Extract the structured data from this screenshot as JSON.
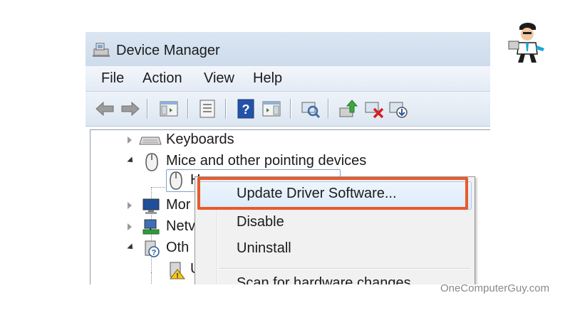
{
  "window": {
    "title": "Device Manager"
  },
  "menu": {
    "items": [
      "File",
      "Action",
      "View",
      "Help"
    ]
  },
  "toolbar": {
    "buttons": [
      "back-arrow-icon",
      "forward-arrow-icon",
      "show-hide-console-tree-icon",
      "properties-icon",
      "help-icon",
      "show-action-pane-icon",
      "scan-hardware-icon",
      "update-driver-icon",
      "uninstall-device-icon",
      "enable-device-icon"
    ]
  },
  "tree": {
    "items": [
      {
        "label": "Keyboards",
        "expanded": false,
        "icon": "keyboard-icon"
      },
      {
        "label": "Mice and other pointing devices",
        "expanded": true,
        "icon": "mouse-icon"
      },
      {
        "label": "H",
        "expanded": null,
        "icon": "mouse-icon",
        "selected": true
      },
      {
        "label": "Mor",
        "expanded": false,
        "icon": "monitor-icon"
      },
      {
        "label": "Netv",
        "expanded": false,
        "icon": "network-icon"
      },
      {
        "label": "Oth",
        "expanded": true,
        "icon": "other-devices-icon"
      },
      {
        "label": "U",
        "expanded": null,
        "icon": "warning-device-icon"
      }
    ]
  },
  "context_menu": {
    "items": [
      "Update Driver Software...",
      "Disable",
      "Uninstall",
      "Scan for hardware changes"
    ],
    "highlighted_item": "Update Driver Software..."
  },
  "watermark": {
    "text": "OneComputerGuy.com"
  },
  "colors": {
    "highlight_border": "#ea5a2b",
    "title_bar": "#d6e2f0"
  }
}
